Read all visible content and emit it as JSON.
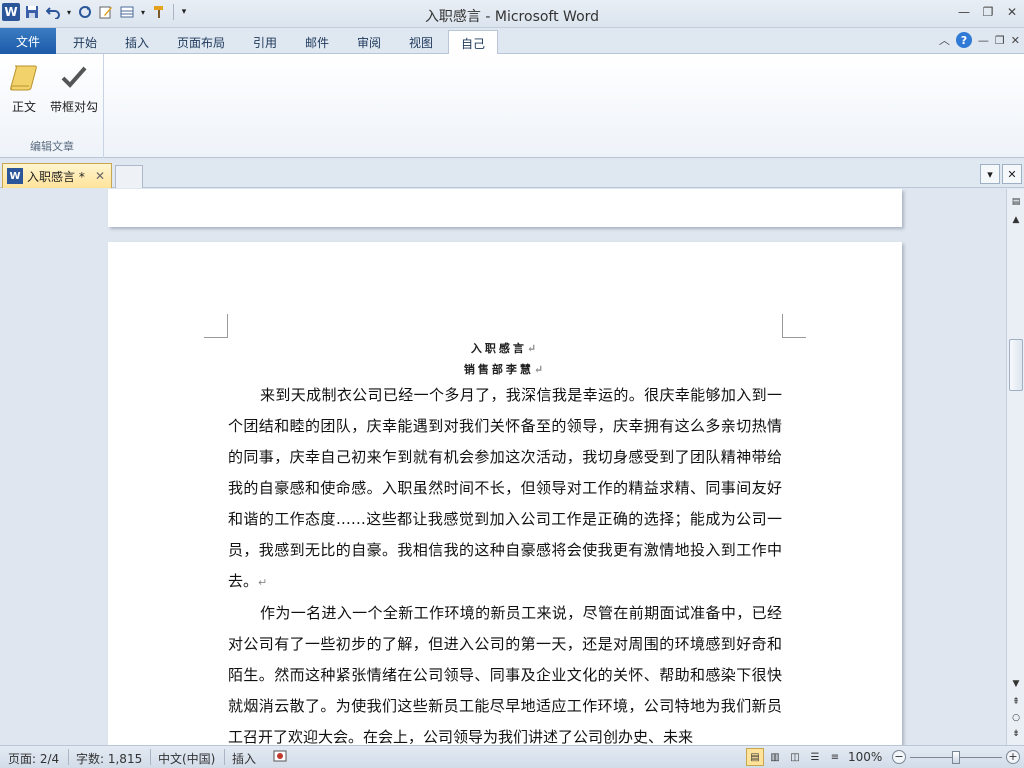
{
  "window": {
    "title": "入职感言 - Microsoft Word"
  },
  "quick_access": {
    "icons": [
      "word-logo",
      "save-icon",
      "undo-icon",
      "redo-icon",
      "edit-icon",
      "insert-table-icon",
      "format-painter-icon",
      "customize-icon"
    ]
  },
  "tabs": [
    {
      "label": "文件"
    },
    {
      "label": "开始"
    },
    {
      "label": "插入"
    },
    {
      "label": "页面布局"
    },
    {
      "label": "引用"
    },
    {
      "label": "邮件"
    },
    {
      "label": "审阅"
    },
    {
      "label": "视图"
    },
    {
      "label": "自己",
      "active": true
    }
  ],
  "ribbon": {
    "buttons": [
      {
        "label": "正文",
        "icon": "scroll-icon"
      },
      {
        "label": "带框对勾",
        "icon": "checkmark-icon"
      }
    ],
    "group_label": "编辑文章"
  },
  "doc_tab": {
    "label": "入职感言 *"
  },
  "document": {
    "title": "入职感言",
    "author": "销售部李慧",
    "paragraphs": [
      "来到天成制衣公司已经一个多月了，我深信我是幸运的。很庆幸能够加入到一个团结和睦的团队，庆幸能遇到对我们关怀备至的领导，庆幸拥有这么多亲切热情的同事，庆幸自己初来乍到就有机会参加这次活动，我切身感受到了团队精神带给我的自豪感和使命感。入职虽然时间不长，但领导对工作的精益求精、同事间友好和谐的工作态度……这些都让我感觉到加入公司工作是正确的选择；能成为公司一员，我感到无比的自豪。我相信我的这种自豪感将会使我更有激情地投入到工作中去。",
      "作为一名进入一个全新工作环境的新员工来说，尽管在前期面试准备中，已经对公司有了一些初步的了解，但进入公司的第一天，还是对周围的环境感到好奇和陌生。然而这种紧张情绪在公司领导、同事及企业文化的关怀、帮助和感染下很快就烟消云散了。为使我们这些新员工能尽早地适应工作环境，公司特地为我们新员工召开了欢迎大会。在会上，公司领导为我们讲述了公司创办史、未来"
    ],
    "mark": "↵"
  },
  "status": {
    "page": "页面: 2/4",
    "words": "字数: 1,815",
    "language": "中文(中国)",
    "mode": "插入",
    "zoom": "100%",
    "zoom_level": 1.0
  },
  "colors": {
    "file_tab": "#2b579a",
    "accent": "#ffe39a"
  }
}
